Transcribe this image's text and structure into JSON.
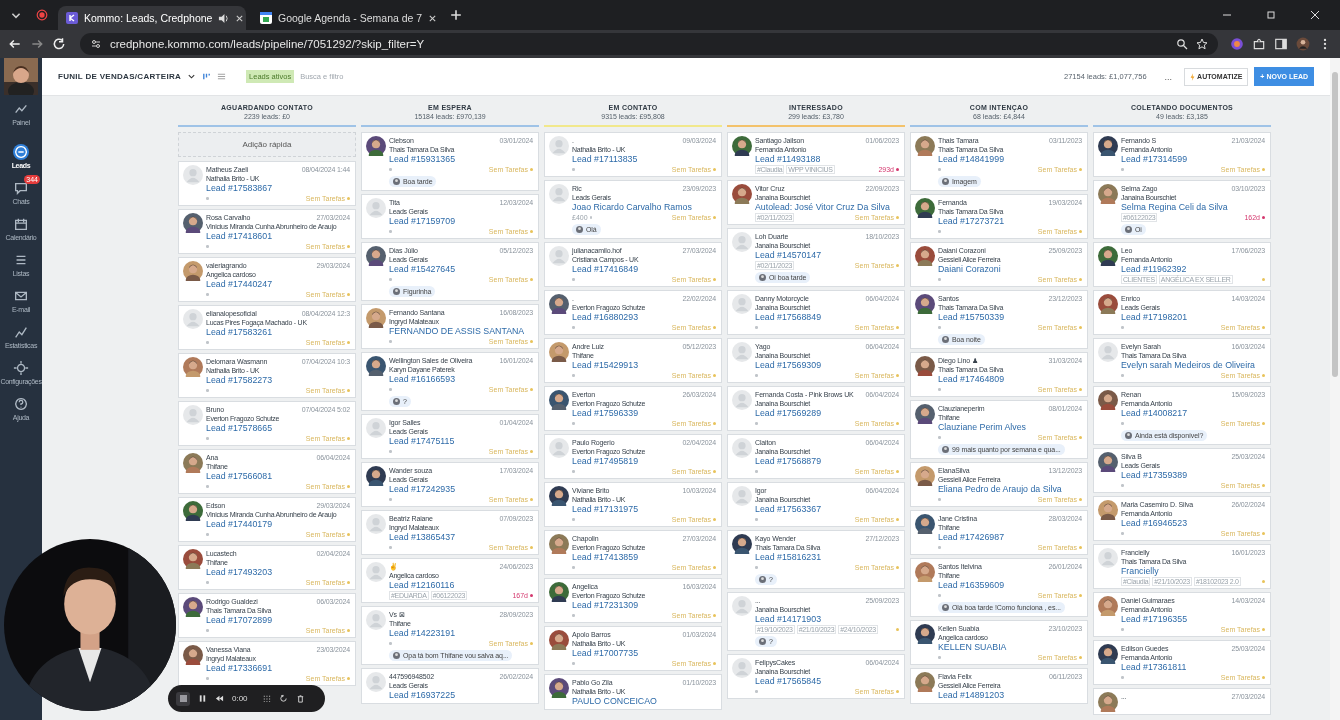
{
  "browser": {
    "tabs": [
      {
        "title": "Kommo: Leads, Credphone",
        "selected": true,
        "audio": true
      },
      {
        "title": "Google Agenda - Semana de 7",
        "selected": false,
        "audio": false
      }
    ],
    "url": "credphone.kommo.com/leads/pipeline/7051292/?skip_filter=Y"
  },
  "sidebar": {
    "items": [
      {
        "label": "Painel",
        "selected": false
      },
      {
        "label": "Leads",
        "selected": true
      },
      {
        "label": "Chats",
        "selected": false,
        "badge": "344"
      },
      {
        "label": "Calendário",
        "selected": false
      },
      {
        "label": "Listas",
        "selected": false
      },
      {
        "label": "E-mail",
        "selected": false
      },
      {
        "label": "Estatísticas",
        "selected": false
      },
      {
        "label": "Configurações",
        "selected": false
      },
      {
        "label": "Ajuda",
        "selected": false
      }
    ]
  },
  "header": {
    "pipeline": "FUNIL DE VENDAS/CARTEIRA",
    "filter_chip": "Leads ativos",
    "search": {
      "placeholder": "Busca e filtro"
    },
    "summary": "27154 leads: £1,077,756",
    "more": "...",
    "buttons": [
      "AUTOMATIZE",
      "+ NOVO LEAD"
    ]
  },
  "quick_add": "Adição rápida",
  "columns": [
    {
      "title": "AGUARDANDO CONTATO",
      "summary": "2239 leads: £0",
      "color": "#9fc3e7",
      "cards": [
        {
          "kind": "default",
          "name": "Matheus Zaeli",
          "date": "08/04/2024 1:44",
          "owner": "Nathalia Brito - UK",
          "title": "Lead #17583867",
          "task": "Sem Tarefas",
          "overdue": false
        },
        {
          "name": "Rosa Carvalho",
          "date": "27/03/2024",
          "owner": "Vinicius Miranda Cunha Abrunheiro de Araujo",
          "title": "Lead #17418601",
          "task": "Sem Tarefas",
          "overdue": false
        },
        {
          "name": "valeriagrando",
          "date": "29/03/2024",
          "owner": "Angelica cardoso",
          "title": "Lead #17440247",
          "task": "Sem Tarefas",
          "overdue": false
        },
        {
          "kind": "default",
          "name": "elianalopesoficial",
          "date": "08/04/2024 12:3",
          "owner": "Lucas Pires Fogaça Machado - UK",
          "title": "Lead #17583261",
          "task": "Sem Tarefas",
          "overdue": false
        },
        {
          "name": "Delomara Wasmann",
          "date": "07/04/2024 10:3",
          "owner": "Nathalia Brito - UK",
          "title": "Lead #17582273",
          "task": "Sem Tarefas",
          "overdue": false
        },
        {
          "kind": "default",
          "name": "Bruno",
          "date": "07/04/2024 5:02",
          "owner": "Everton Fragozo Schutze",
          "title": "Lead #17578665",
          "task": "Sem Tarefas",
          "overdue": false
        },
        {
          "name": "Ana",
          "date": "06/04/2024",
          "owner": "Thifane",
          "title": "Lead #17566081",
          "task": "Sem Tarefas",
          "overdue": false
        },
        {
          "name": "Edson",
          "date": "29/03/2024",
          "owner": "Vinicius Miranda Cunha Abrunheiro de Araujo",
          "title": "Lead #17440179",
          "task": "Sem Tarefas",
          "overdue": false
        },
        {
          "name": "Lucastech",
          "date": "02/04/2024",
          "owner": "Thifane",
          "title": "Lead #17493203",
          "task": "Sem Tarefas",
          "overdue": false
        },
        {
          "name": "Rodrigo Gualdezi",
          "date": "06/03/2024",
          "owner": "Thais Tamara Da Silva",
          "title": "Lead #17072899",
          "task": "Sem Tarefas",
          "overdue": false
        },
        {
          "name": "Vanessa Viana",
          "date": "23/03/2024",
          "owner": "Ingryd Malateaux",
          "title": "Lead #17336691",
          "task": "Sem Tarefas",
          "overdue": false
        }
      ]
    },
    {
      "title": "EM ESPERA",
      "summary": "15184 leads: £970,139",
      "color": "#9fc3e7",
      "cards": [
        {
          "name": "Clebson",
          "date": "03/01/2024",
          "owner": "Thais Tamara Da Silva",
          "title": "Lead #15931365",
          "task": "Sem Tarefas",
          "overdue": false,
          "message": "Boa tarde"
        },
        {
          "kind": "default",
          "name": "Tita",
          "date": "12/03/2024",
          "owner": "Leads Gerais",
          "title": "Lead #17159709",
          "task": "Sem Tarefas",
          "overdue": false
        },
        {
          "name": "Dias Júlio",
          "date": "05/12/2023",
          "owner": "Leads Gerais",
          "title": "Lead #15427645",
          "task": "Sem Tarefas",
          "overdue": false,
          "message": "Figurinha"
        },
        {
          "name": "Fernando Santana",
          "date": "16/08/2023",
          "owner": "Ingryd Malateaux",
          "title": "FERNANDO DE ASSIS SANTANA",
          "task": "Sem Tarefas",
          "overdue": false
        },
        {
          "name": "Wellington Sales de Oliveira",
          "date": "16/01/2024",
          "owner": "Karyn Dayane Paterek",
          "title": "Lead #16166593",
          "task": "Sem Tarefas",
          "overdue": false,
          "message": "?"
        },
        {
          "kind": "default",
          "name": "Igor Salles",
          "date": "01/04/2024",
          "owner": "Leads Gerais",
          "title": "Lead #17475115",
          "task": "Sem Tarefas",
          "overdue": false
        },
        {
          "name": "Wander souza",
          "date": "17/03/2024",
          "owner": "Leads Gerais",
          "title": "Lead #17242935",
          "task": "Sem Tarefas",
          "overdue": false
        },
        {
          "kind": "default",
          "name": "Beatriz Raiane",
          "date": "07/09/2023",
          "owner": "Ingryd Malateaux",
          "title": "Lead #13865437",
          "task": "Sem Tarefas",
          "overdue": false
        },
        {
          "kind": "default",
          "name": "✌",
          "date": "24/06/2023",
          "owner": "Angelica cardoso",
          "title": "Lead #12160116",
          "tags": [
            "#EDUARDA",
            "#06122023"
          ],
          "task": "167d",
          "overdue": true
        },
        {
          "kind": "default",
          "name": "Vs ⊠",
          "date": "28/09/2023",
          "owner": "Thifane",
          "title": "Lead #14223191",
          "task": "Sem Tarefas",
          "overdue": false,
          "message": "Opa tá bom Thifane vou salva aq..."
        },
        {
          "kind": "default",
          "name": "447596948502",
          "date": "26/02/2024",
          "owner": "Leads Gerais",
          "title": "Lead #16937225"
        }
      ]
    },
    {
      "title": "EM CONTATO",
      "summary": "9315 leads: £95,808",
      "color": "#f1e88c",
      "cards": [
        {
          "kind": "default",
          "name": ".",
          "date": "09/03/2024",
          "owner": "Nathalia Brito - UK",
          "title": "Lead #17113835",
          "task": "Sem Tarefas",
          "overdue": false
        },
        {
          "kind": "default",
          "name": "Ric",
          "date": "23/09/2023",
          "owner": "Leads Gerais",
          "title": "Joao Ricardo Carvalho Ramos",
          "price": "£400",
          "task": "Sem Tarefas",
          "overdue": false,
          "message": "Olá"
        },
        {
          "kind": "default",
          "name": "julianacamilo.hof",
          "date": "27/03/2024",
          "owner": "Cristiana Campos - UK",
          "title": "Lead #17416849",
          "task": "Sem Tarefas",
          "overdue": false
        },
        {
          "name": ".",
          "date": "22/02/2024",
          "owner": "Everton Fragozo Schutze",
          "title": "Lead #16880293",
          "task": "Sem Tarefas",
          "overdue": false
        },
        {
          "name": "Andre Luiz",
          "date": "05/12/2023",
          "owner": "Thifane",
          "title": "Lead #15429913",
          "task": "Sem Tarefas",
          "overdue": false
        },
        {
          "name": "Everton",
          "date": "26/03/2024",
          "owner": "Everton Fragozo Schutze",
          "title": "Lead #17596339",
          "task": "Sem Tarefas",
          "overdue": false
        },
        {
          "kind": "default",
          "name": "Paulo Rogerio",
          "date": "02/04/2024",
          "owner": "Everton Fragozo Schutze",
          "title": "Lead #17495819",
          "task": "Sem Tarefas",
          "overdue": false
        },
        {
          "name": "Viviane Brito",
          "date": "10/03/2024",
          "owner": "Nathalia Brito - UK",
          "title": "Lead #17131975",
          "task": "Sem Tarefas",
          "overdue": false
        },
        {
          "name": "Chapolin",
          "date": "27/03/2024",
          "owner": "Everton Fragozo Schutze",
          "title": "Lead #17413859",
          "task": "Sem Tarefas",
          "overdue": false
        },
        {
          "name": "Angelica",
          "date": "16/03/2024",
          "owner": "Everton Fragozo Schutze",
          "title": "Lead #17231309",
          "task": "Sem Tarefas",
          "overdue": false
        },
        {
          "name": "Apolo Barros",
          "date": "01/03/2024",
          "owner": "Nathalia Brito - UK",
          "title": "Lead #17007735",
          "task": "Sem Tarefas",
          "overdue": false
        },
        {
          "name": "Pablo Go Zila",
          "date": "01/10/2023",
          "owner": "Nathalia Brito - UK",
          "title": "PAULO CONCEICAO"
        }
      ]
    },
    {
      "title": "INTERESSADO",
      "summary": "299 leads: £3,780",
      "color": "#f3c26b",
      "cards": [
        {
          "name": "Santiago Jailson",
          "date": "01/06/2023",
          "owner": "Fernanda Antonio",
          "title": "Lead #11493188",
          "tags": [
            "#Claudia",
            "WPP VINICIUS"
          ],
          "task": "293d",
          "overdue": true
        },
        {
          "name": "Vitor Cruz",
          "date": "22/09/2023",
          "owner": "Janaina Bourschiet",
          "title": "Autolead: José Vitor Cruz Da Silva",
          "tags": [
            "#02/11/2023"
          ],
          "task": "Sem Tarefas",
          "overdue": false
        },
        {
          "kind": "default",
          "name": "Loh Duarte",
          "date": "18/10/2023",
          "owner": "Janaina Bourschiet",
          "title": "Lead #14570147",
          "tags": [
            "#02/11/2023"
          ],
          "task": "Sem Tarefas",
          "overdue": false,
          "message": "Oi boa tarde"
        },
        {
          "kind": "default",
          "name": "Danny Motorcycle",
          "date": "06/04/2024",
          "owner": "Janaina Bourschiet",
          "title": "Lead #17568849",
          "task": "Sem Tarefas",
          "overdue": false
        },
        {
          "kind": "default",
          "name": "Yago",
          "date": "06/04/2024",
          "owner": "Janaina Bourschiet",
          "title": "Lead #17569309",
          "task": "Sem Tarefas",
          "overdue": false
        },
        {
          "kind": "default",
          "name": "Fernanda Costa - Pink Brows UK",
          "date": "06/04/2024",
          "owner": "Janaina Bourschiet",
          "title": "Lead #17569289",
          "task": "Sem Tarefas",
          "overdue": false
        },
        {
          "kind": "default",
          "name": "Claiton",
          "date": "06/04/2024",
          "owner": "Janaina Bourschiet",
          "title": "Lead #17568879",
          "task": "Sem Tarefas",
          "overdue": false
        },
        {
          "kind": "default",
          "name": "Igor",
          "date": "06/04/2024",
          "owner": "Janaina Bourschiet",
          "title": "Lead #17563367",
          "task": "Sem Tarefas",
          "overdue": false
        },
        {
          "name": "Kayo Wender",
          "date": "27/12/2023",
          "owner": "Thais Tamara Da Silva",
          "title": "Lead #15816231",
          "task": "Sem Tarefas",
          "overdue": false,
          "message": "?"
        },
        {
          "kind": "default",
          "name": "...",
          "date": "25/09/2023",
          "owner": "Janaina Bourschiet",
          "title": "Lead #14171903",
          "tags": [
            "#19/10/2023",
            "#21/10/2023",
            "#24/10/2023"
          ],
          "message": "?"
        },
        {
          "kind": "default",
          "name": "FelipysCakes",
          "date": "06/04/2024",
          "owner": "Janaina Bourschiet",
          "title": "Lead #17565845",
          "task": "Sem Tarefas",
          "overdue": false
        }
      ]
    },
    {
      "title": "COM INTENÇAO",
      "summary": "68 leads: £4,844",
      "color": "#9fc3e7",
      "cards": [
        {
          "name": "Thais Tamara",
          "date": "03/11/2023",
          "owner": "Thais Tamara Da Silva",
          "title": "Lead #14841999",
          "task": "Sem Tarefas",
          "overdue": false,
          "message": "Imagem"
        },
        {
          "name": "Fernanda",
          "date": "19/03/2024",
          "owner": "Thais Tamara Da Silva",
          "title": "Lead #17273721",
          "task": "Sem Tarefas",
          "overdue": false
        },
        {
          "name": "Daiani Corazoni",
          "date": "25/09/2023",
          "owner": "Gessieli Alice Ferreira",
          "title": "Daiani Corazoni",
          "task": "Sem Tarefas",
          "overdue": false
        },
        {
          "name": "Santos",
          "date": "23/12/2023",
          "owner": "Thais Tamara Da Silva",
          "title": "Lead #15750339",
          "task": "Sem Tarefas",
          "overdue": false,
          "message": "Boa noite"
        },
        {
          "name": "Diego Lino ♟",
          "date": "31/03/2024",
          "owner": "Thais Tamara Da Silva",
          "title": "Lead #17464809",
          "task": "Sem Tarefas",
          "overdue": false
        },
        {
          "name": "Clauzianeperim",
          "date": "08/01/2024",
          "owner": "Thifane",
          "title": "Clauziane Perim Alves",
          "task": "Sem Tarefas",
          "overdue": false,
          "message": "99 mais quanto por semana e qua..."
        },
        {
          "name": "ElanaSilva",
          "date": "13/12/2023",
          "owner": "Gessieli Alice Ferreira",
          "title": "Eliana Pedro de Araujo da Silva",
          "task": "Sem Tarefas",
          "overdue": false
        },
        {
          "name": "Jane Cristina",
          "date": "28/03/2024",
          "owner": "Thifane",
          "title": "Lead #17426987",
          "task": "Sem Tarefas",
          "overdue": false
        },
        {
          "name": "Santos Itelvina",
          "date": "26/01/2024",
          "owner": "Thifane",
          "title": "Lead #16359609",
          "task": "Sem Tarefas",
          "overdue": false,
          "message": "Olá boa tarde !Como funciona , es..."
        },
        {
          "name": "Kellen Suabia",
          "date": "23/10/2023",
          "owner": "Angelica cardoso",
          "title": "KELLEN SUABIA",
          "task": "Sem Tarefas",
          "overdue": false
        },
        {
          "name": "Flavia Felix",
          "date": "06/11/2023",
          "owner": "Gessieli Alice Ferreira",
          "title": "Lead #14891203"
        }
      ]
    },
    {
      "title": "COLETANDO DOCUMENTOS",
      "summary": "49 leads: £3,185",
      "color": "#9fc3e7",
      "cards": [
        {
          "name": "Fernando S",
          "date": "21/03/2024",
          "owner": "Fernanda Antonio",
          "title": "Lead #17314599",
          "task": "Sem Tarefas",
          "overdue": false
        },
        {
          "name": "Selma Zago",
          "date": "03/10/2023",
          "owner": "Janaina Bourschiet",
          "title": "Selma Regina Celi da Silva",
          "tags": [
            "#06122023"
          ],
          "task": "162d",
          "overdue": true,
          "message": "Oi"
        },
        {
          "name": "Leo",
          "date": "17/06/2023",
          "owner": "Fernanda Antonio",
          "title": "Lead #11962392",
          "tags": [
            "CLIENTES",
            "ANGÉLICA EX SELLER"
          ]
        },
        {
          "name": "Enrico",
          "date": "14/03/2024",
          "owner": "Leads Gerais",
          "title": "Lead #17198201",
          "task": "Sem Tarefas",
          "overdue": false
        },
        {
          "kind": "default",
          "name": "Evelyn Sarah",
          "date": "16/03/2024",
          "owner": "Thais Tamara Da Silva",
          "title": "Evelyn sarah Medeiros de Oliveira",
          "task": "Sem Tarefas",
          "overdue": false
        },
        {
          "name": "Renan",
          "date": "15/09/2023",
          "owner": "Fernanda Antonio",
          "title": "Lead #14008217",
          "task": "Sem Tarefas",
          "overdue": false,
          "message": "Ainda está disponível?"
        },
        {
          "name": "Silva B",
          "date": "25/03/2024",
          "owner": "Leads Gerais",
          "title": "Lead #17359389",
          "task": "Sem Tarefas",
          "overdue": false
        },
        {
          "name": "Maria Casemiro D. Silva",
          "date": "26/02/2024",
          "owner": "Fernanda Antonio",
          "title": "Lead #16946523",
          "task": "Sem Tarefas",
          "overdue": false
        },
        {
          "kind": "default",
          "name": "Francielly",
          "date": "16/01/2023",
          "owner": "Thais Tamara Da Silva",
          "title": "Francielly",
          "tags": [
            "#Claudia",
            "#21/10/2023",
            "#18102023 2.0"
          ]
        },
        {
          "name": "Daniel Guimaraes",
          "date": "14/03/2024",
          "owner": "Fernanda Antonio",
          "title": "Lead #17196355",
          "task": "Sem Tarefas",
          "overdue": false
        },
        {
          "name": "Edilson Guedes",
          "date": "25/03/2024",
          "owner": "Fernanda Antonio",
          "title": "Lead #17361811",
          "task": "Sem Tarefas",
          "overdue": false
        },
        {
          "name": "...",
          "date": "27/03/2024"
        }
      ]
    }
  ],
  "recorder": {
    "time": "0:00"
  }
}
